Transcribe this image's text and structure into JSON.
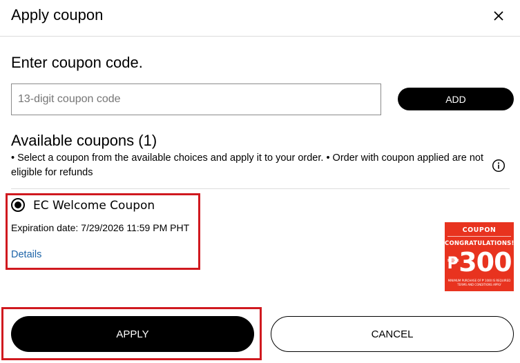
{
  "header": {
    "title": "Apply coupon",
    "close_icon": "close-icon"
  },
  "entry": {
    "label": "Enter coupon code.",
    "placeholder": "13-digit coupon code",
    "value": "",
    "add_label": "ADD"
  },
  "available": {
    "title": "Available coupons (1)",
    "description": "• Select a coupon from the available choices and apply it to your order. • Order with coupon applied are not eligible for refunds",
    "info_icon": "info-icon"
  },
  "coupons": [
    {
      "name": "EC Welcome Coupon",
      "selected": true,
      "expiry": "Expiration date: 7/29/2026 11:59 PM PHT",
      "details_label": "Details",
      "image": {
        "heading": "COUPON",
        "congrats": "CONGRATULATIONS!",
        "currency": "₱",
        "amount": "300",
        "fine_print_1": "MINIMUM PURCHASE OF ₱ 1000 IS REQUIRED",
        "fine_print_2": "TERMS AND CONDITIONS APPLY",
        "color": "#e8331f"
      }
    }
  ],
  "actions": {
    "apply_label": "APPLY",
    "cancel_label": "CANCEL"
  },
  "colors": {
    "highlight": "#d0191f",
    "link": "#1b63a8",
    "primary": "#000000"
  }
}
